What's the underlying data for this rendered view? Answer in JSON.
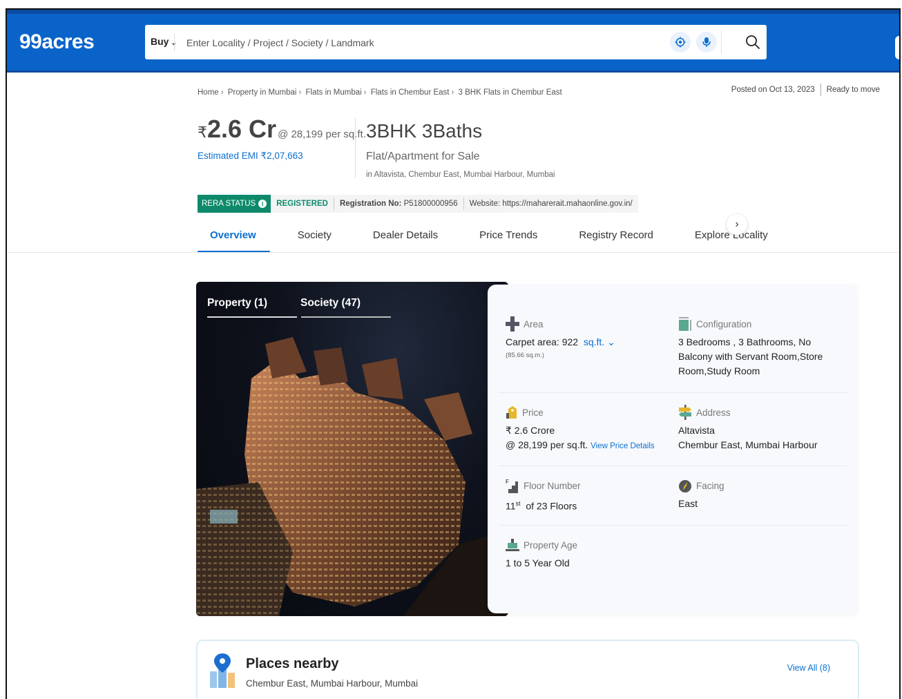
{
  "header": {
    "logo": "99acres",
    "buy_label": "Buy",
    "search_placeholder": "Enter Locality / Project / Society / Landmark"
  },
  "breadcrumb": [
    "Home",
    "Property in Mumbai",
    "Flats in Mumbai",
    "Flats in Chembur East",
    "3 BHK Flats in Chembur East"
  ],
  "posted": "Posted on Oct 13, 2023",
  "availability": "Ready to move",
  "price": {
    "currency": "₹",
    "amount": "2.6 Cr",
    "per_sqft": "@ 28,199 per sq.ft.",
    "emi": "Estimated EMI ₹2,07,663"
  },
  "listing": {
    "title": "3BHK 3Baths",
    "type": "Flat/Apartment for Sale",
    "location": "in Altavista, Chembur East, Mumbai Harbour, Mumbai"
  },
  "rera": {
    "status_label": "RERA STATUS",
    "status": "REGISTERED",
    "reg_label": "Registration No:",
    "reg_no": "P51800000956",
    "website": "Website: https://maharerait.mahaonline.gov.in/"
  },
  "tabs": [
    "Overview",
    "Society",
    "Dealer Details",
    "Price Trends",
    "Registry Record",
    "Explore Locality"
  ],
  "gallery": {
    "tab_property": "Property (1)",
    "tab_society": "Society (47)"
  },
  "details": {
    "area": {
      "label": "Area",
      "value": "Carpet area: 922",
      "unit": "sq.ft.",
      "sub": "(85.66 sq.m.)"
    },
    "configuration": {
      "label": "Configuration",
      "value": "3 Bedrooms , 3 Bathrooms, No Balcony with Servant Room,Store Room,Study Room"
    },
    "price": {
      "label": "Price",
      "value": "₹ 2.6 Crore",
      "per_sqft": "@ 28,199 per sq.ft.",
      "link": "View Price Details"
    },
    "address": {
      "label": "Address",
      "line1": "Altavista",
      "line2": "Chembur East, Mumbai Harbour"
    },
    "floor": {
      "label": "Floor Number",
      "num": "11",
      "sup": "st",
      "rest": "of 23 Floors"
    },
    "facing": {
      "label": "Facing",
      "value": "East"
    },
    "age": {
      "label": "Property Age",
      "value": "1 to 5 Year Old"
    }
  },
  "nearby": {
    "title": "Places nearby",
    "subtitle": "Chembur East, Mumbai Harbour, Mumbai",
    "view_all": "View All (8)"
  },
  "colors": {
    "brand": "#0a63c8",
    "rera_green": "#0e8a6b",
    "link": "#0b6fd0"
  }
}
